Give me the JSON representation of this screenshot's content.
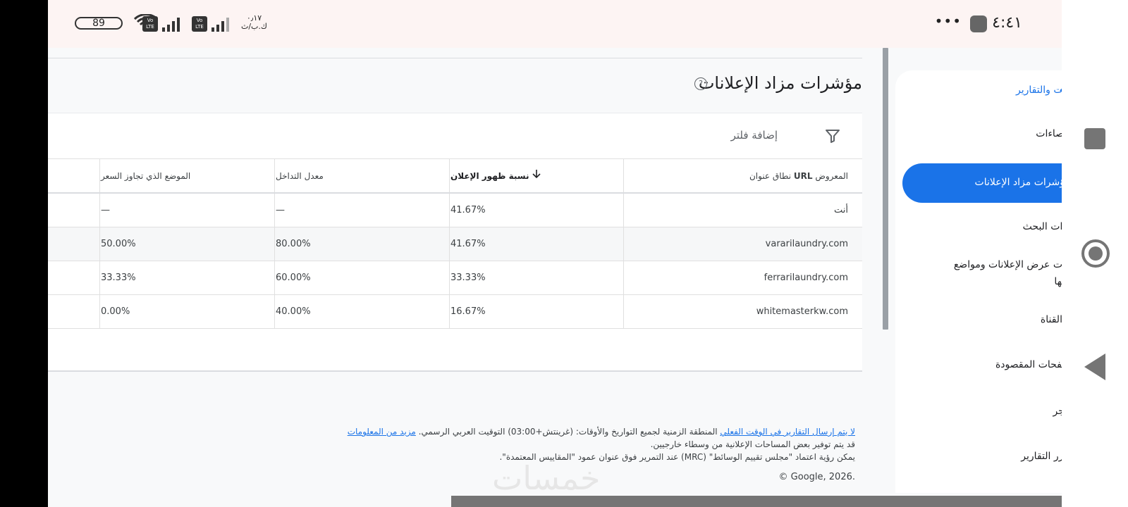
{
  "status_bar": {
    "battery": "89",
    "network_speed_line1": "٠٫١٧",
    "network_speed_line2": "ك.ب/ث",
    "volte1": "Vo LTE",
    "volte2": "Vo LTE",
    "time": "٤:٤١",
    "more": "•••"
  },
  "page": {
    "title": "مؤشرات مزاد الإعلانات",
    "help_icon": "?"
  },
  "filter": {
    "label": "إضافة فلتر",
    "icon": "filter-icon"
  },
  "table": {
    "headers": {
      "domain_pre": "نطاق عنوان ",
      "domain_bold": "URL",
      "domain_post": " المعروض",
      "impression_share": "نسبة ظهور الإعلان",
      "overlap_rate": "معدل التداخل",
      "outranking_share": "الموضع الذي تجاوز السعر"
    },
    "rows": [
      {
        "domain": "أنت",
        "impression_share": "41.67%",
        "overlap_rate": "—",
        "outranking_share": "—"
      },
      {
        "domain": "vararilaundry.com",
        "impression_share": "41.67%",
        "overlap_rate": "80.00%",
        "outranking_share": "50.00%"
      },
      {
        "domain": "ferrarilaundry.com",
        "impression_share": "33.33%",
        "overlap_rate": "60.00%",
        "outranking_share": "33.33%"
      },
      {
        "domain": "whitemasterkw.com",
        "impression_share": "16.67%",
        "overlap_rate": "40.00%",
        "outranking_share": "0.00%"
      }
    ]
  },
  "footer": {
    "line1_link": "لا يتم إرسال التقارير في الوقت الفعلي",
    "line1_text": " المنطقة الزمنية لجميع التواريخ والأوقات: (غرينتش+03:00) التوقيت العربي الرسمي. ",
    "line1_more": "مزيد من المعلومات",
    "line2": "قد يتم توفير بعض المساحات الإعلانية من وسطاء خارجيين.",
    "line3": "يمكن رؤية اعتماد \"مجلس تقييم الوسائط\" (MRC) عند التمرير فوق عنوان عمود \"المقاييس المعتمدة\".",
    "copyright": "© Google, 2026."
  },
  "watermark": "خمسات",
  "sidenav": {
    "top_fragment": "...",
    "section": "ءات والتقارير",
    "items": [
      "حصاءات",
      "ؤشرات مزاد الإعلانات",
      "ارات البحث",
      "قات عرض الإعلانات ومواضع",
      "ضها",
      "ء القناة",
      "سفحات المقصودة",
      "تاجر",
      "حرر التقارير"
    ]
  }
}
